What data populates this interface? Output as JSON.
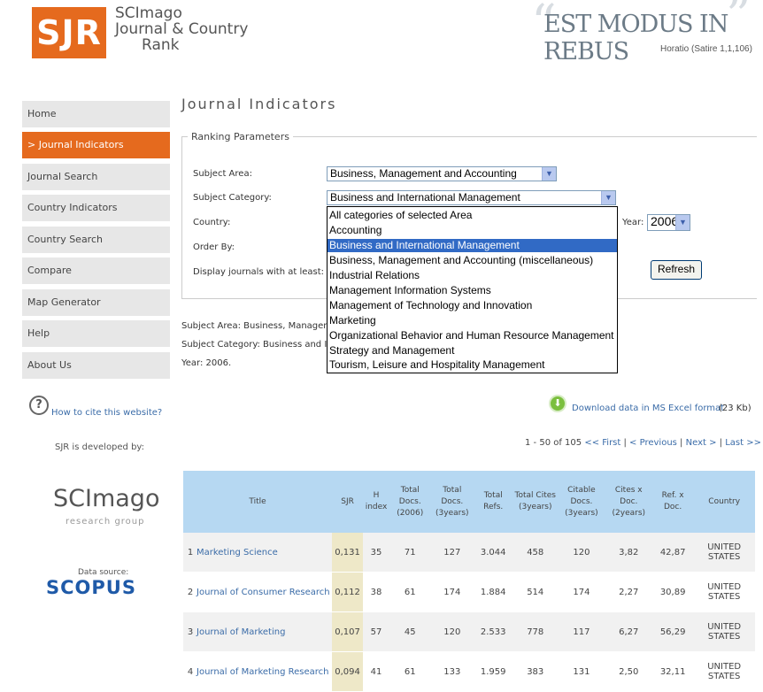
{
  "header": {
    "logo": "SJR",
    "logo_line1": "SCImago",
    "logo_line2": "Journal & Country",
    "logo_line3": "Rank",
    "motto": "EST MODUS IN REBUS",
    "motto_sub": "Horatio (Satire 1,1,106)"
  },
  "nav": [
    {
      "label": "Home"
    },
    {
      "label": "> Journal Indicators"
    },
    {
      "label": "Journal Search"
    },
    {
      "label": "Country Indicators"
    },
    {
      "label": "Country Search"
    },
    {
      "label": "Compare"
    },
    {
      "label": "Map Generator"
    },
    {
      "label": "Help"
    },
    {
      "label": "About Us"
    }
  ],
  "cite_link": "How to cite this website?",
  "developed_by": "SJR is developed by:",
  "scimago": "SCImago",
  "scimago_sub": "research group",
  "data_source": "Data source:",
  "scopus": "SCOPUS",
  "page_title": "Journal Indicators",
  "ranking_legend": "Ranking Parameters",
  "labels": {
    "subject_area": "Subject Area:",
    "subject_category": "Subject Category:",
    "country": "Country:",
    "order_by": "Order By:",
    "display_at_least": "Display journals with at least:",
    "year": "Year:"
  },
  "selects": {
    "subject_area": "Business, Management and Accounting",
    "subject_category": "Business and International Management",
    "year": "2006"
  },
  "dropdown_options": [
    "All categories of selected Area",
    "Accounting",
    "Business and International Management",
    "Business, Management and Accounting (miscellaneous)",
    "Industrial Relations",
    "Management Information Systems",
    "Management of Technology and Innovation",
    "Marketing",
    "Organizational Behavior and Human Resource Management",
    "Strategy and Management",
    "Tourism, Leisure and Hospitality Management"
  ],
  "dropdown_selected_index": 2,
  "refresh_label": "Refresh",
  "summary": {
    "area": "Subject Area: Business, Managem",
    "category": "Subject Category: Business and Ir",
    "year": "Year: 2006."
  },
  "download": "Download data in MS Excel format",
  "download_size": "(23  Kb)",
  "pagination": {
    "range": "1 - 50 of 105",
    "first": "<< First",
    "previous": "< Previous",
    "next": "Next >",
    "last": "Last >>"
  },
  "table": {
    "headers": [
      "Title",
      "SJR",
      "H index",
      "Total Docs. (2006)",
      "Total Docs. (3years)",
      "Total Refs.",
      "Total Cites (3years)",
      "Citable Docs. (3years)",
      "Cites x Doc. (2years)",
      "Ref. x Doc.",
      "Country"
    ],
    "rows": [
      [
        "1",
        "Marketing Science",
        "0,131",
        "35",
        "71",
        "127",
        "3.044",
        "458",
        "120",
        "3,82",
        "42,87",
        "UNITED STATES"
      ],
      [
        "2",
        "Journal of Consumer Research",
        "0,112",
        "38",
        "61",
        "174",
        "1.884",
        "514",
        "174",
        "2,27",
        "30,89",
        "UNITED STATES"
      ],
      [
        "3",
        "Journal of Marketing",
        "0,107",
        "57",
        "45",
        "120",
        "2.533",
        "778",
        "117",
        "6,27",
        "56,29",
        "UNITED STATES"
      ],
      [
        "4",
        "Journal of Marketing Research",
        "0,094",
        "41",
        "61",
        "133",
        "1.959",
        "383",
        "131",
        "2,50",
        "32,11",
        "UNITED STATES"
      ]
    ]
  },
  "colors": {
    "accent": "#e56a1e",
    "table_header": "#b6d8f2",
    "sjr_cell": "#eee8c8",
    "link": "#3b6ca8"
  }
}
